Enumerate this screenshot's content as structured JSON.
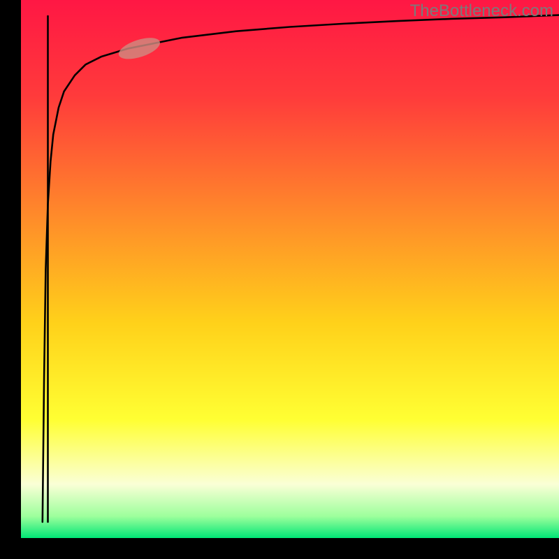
{
  "watermark": "TheBottleneck.com",
  "chart_data": {
    "type": "line",
    "title": "",
    "xlabel": "",
    "ylabel": "",
    "xlim": [
      0,
      100
    ],
    "ylim": [
      0,
      100
    ],
    "background": {
      "type": "vertical-gradient",
      "stops": [
        {
          "offset": 0.0,
          "color": "#ff1744"
        },
        {
          "offset": 0.18,
          "color": "#ff3b3b"
        },
        {
          "offset": 0.4,
          "color": "#ff8a2a"
        },
        {
          "offset": 0.6,
          "color": "#ffd11a"
        },
        {
          "offset": 0.78,
          "color": "#ffff33"
        },
        {
          "offset": 0.9,
          "color": "#faffd6"
        },
        {
          "offset": 0.96,
          "color": "#9cff9c"
        },
        {
          "offset": 1.0,
          "color": "#00e676"
        }
      ]
    },
    "axes": {
      "show_ticks": false,
      "show_grid": false,
      "left_border": true,
      "bottom_border": true,
      "color": "#000000",
      "thickness": 30
    },
    "series": [
      {
        "name": "curve",
        "stroke": "#000000",
        "stroke_width": 2.6,
        "x": [
          4.0,
          4.3,
          4.6,
          5.0,
          5.5,
          6.0,
          7.0,
          8.0,
          10,
          12,
          15,
          20,
          25,
          30,
          40,
          50,
          60,
          70,
          80,
          90,
          100
        ],
        "y": [
          3.0,
          30,
          50,
          62,
          70,
          75,
          80,
          83,
          86,
          88,
          89.5,
          91,
          92,
          93,
          94.2,
          95,
          95.6,
          96.1,
          96.5,
          96.8,
          97.2
        ]
      },
      {
        "name": "spike",
        "stroke": "#000000",
        "stroke_width": 2.6,
        "x": [
          5.0,
          5.0
        ],
        "y": [
          3.0,
          97.0
        ]
      }
    ],
    "highlight": {
      "name": "pill",
      "shape": "ellipse",
      "cx": 22,
      "cy": 91,
      "rx": 4,
      "ry": 1.6,
      "rotation_deg": -18,
      "fill": "#d08a80",
      "opacity": 0.82
    }
  }
}
